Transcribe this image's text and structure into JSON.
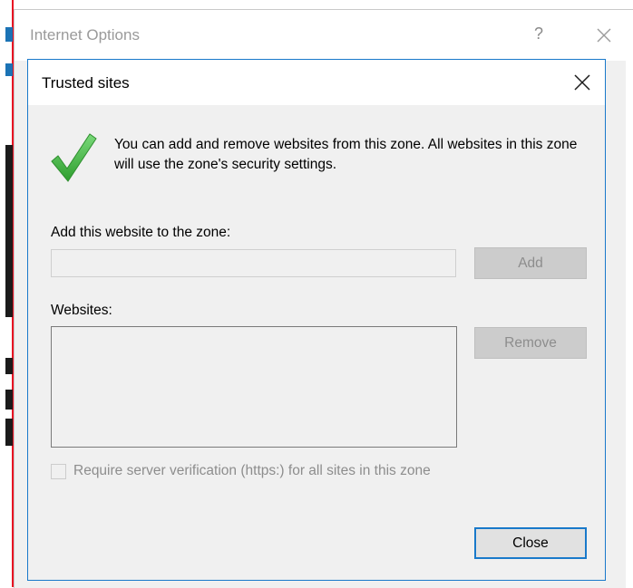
{
  "parent_window": {
    "title": "Internet Options",
    "help_glyph": "?",
    "close_icon": "close-icon"
  },
  "dialog": {
    "title": "Trusted sites",
    "close_icon": "close-icon",
    "info_icon": "checkmark-icon",
    "info_text": "You can add and remove websites from this zone. All websites in this zone will use the zone's security settings.",
    "add_label": "Add this website to the zone:",
    "add_input": {
      "value": "",
      "placeholder": ""
    },
    "add_button_label": "Add",
    "websites_label": "Websites:",
    "websites": [],
    "remove_button_label": "Remove",
    "require_verification": {
      "label": "Require server verification (https:) for all sites in this zone",
      "checked": false,
      "enabled": false
    },
    "close_button_label": "Close"
  },
  "colors": {
    "accent": "#1979ca",
    "check_green": "#3fb53f",
    "disabled_text": "#8d8d8d",
    "dialog_bg": "#f0f0f0"
  }
}
